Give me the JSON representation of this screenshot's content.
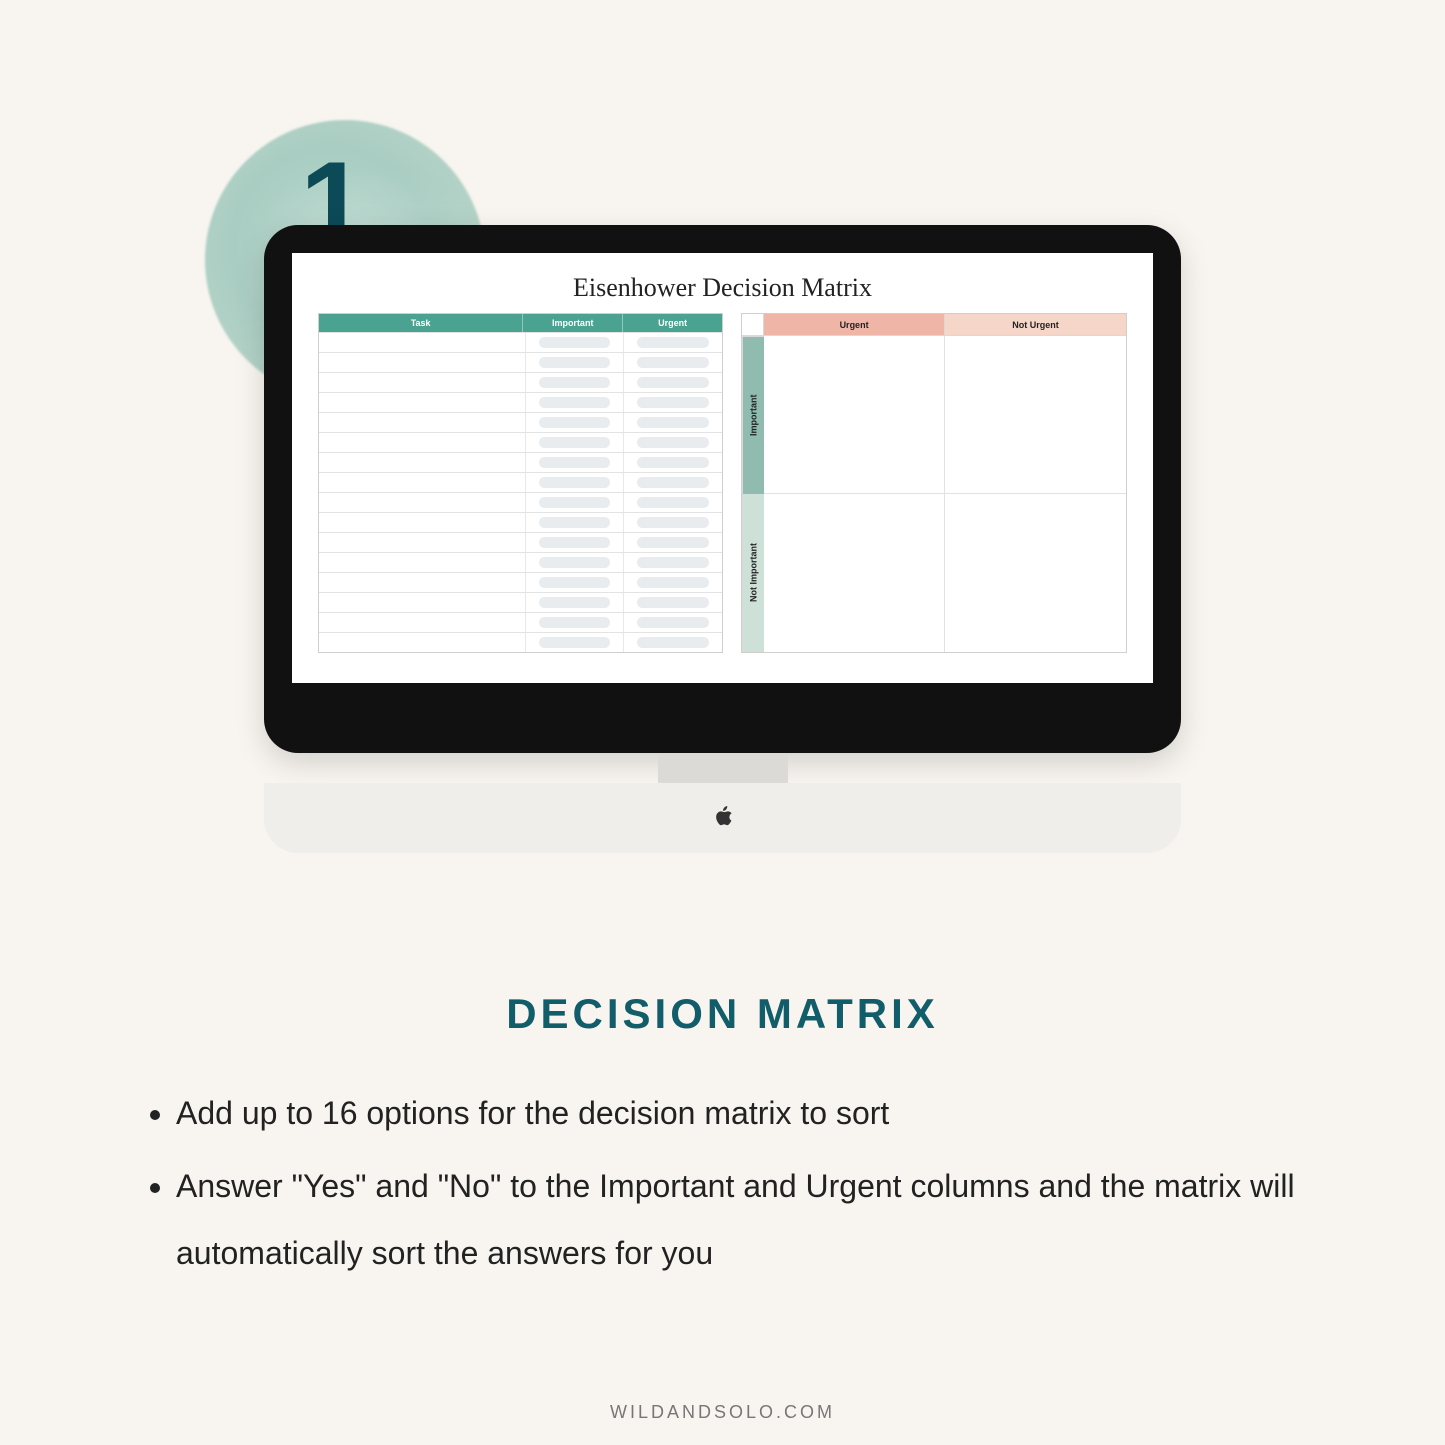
{
  "step_number": "1.",
  "screen": {
    "title": "Eisenhower Decision Matrix",
    "task_table": {
      "headers": {
        "task": "Task",
        "important": "Important",
        "urgent": "Urgent"
      },
      "row_count": 16
    },
    "quadrant": {
      "col1": "Urgent",
      "col2": "Not Urgent",
      "row1": "Important",
      "row2": "Not Important"
    }
  },
  "heading": "DECISION MATRIX",
  "bullets": [
    "Add up to 16 options for the decision matrix to sort",
    "Answer \"Yes\" and \"No\" to the Important and Urgent columns and the matrix will automatically sort the answers for you"
  ],
  "footer": "WILDANDSOLO.COM"
}
